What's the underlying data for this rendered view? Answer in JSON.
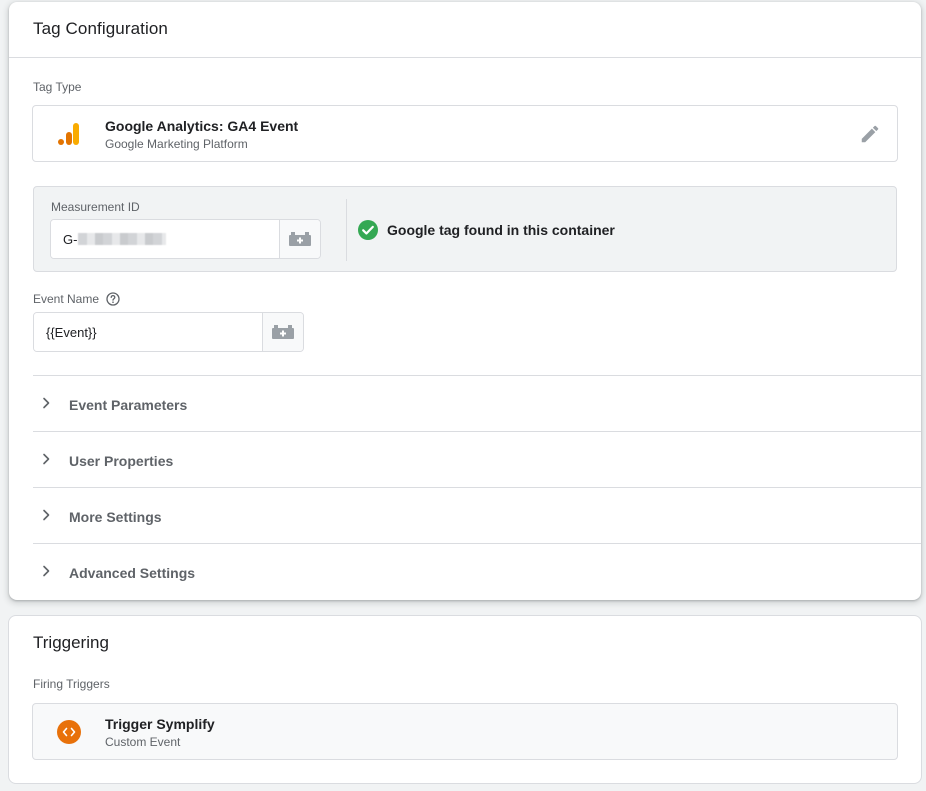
{
  "tag_config": {
    "title": "Tag Configuration",
    "tag_type_label": "Tag Type",
    "tag_type": {
      "name": "Google Analytics: GA4 Event",
      "provider": "Google Marketing Platform",
      "icon": "google-analytics-icon",
      "edit_icon": "pencil-icon"
    },
    "measurement": {
      "label": "Measurement ID",
      "value_prefix": "G-",
      "value_redacted": true,
      "variable_icon": "variable-brick-icon",
      "status_icon": "check-circle-icon",
      "status_text": "Google tag found in this container"
    },
    "event_name": {
      "label": "Event Name",
      "help_icon": "help-circle-icon",
      "value": "{{Event}}",
      "variable_icon": "variable-brick-icon"
    },
    "sections": [
      {
        "label": "Event Parameters",
        "icon": "chevron-right-icon"
      },
      {
        "label": "User Properties",
        "icon": "chevron-right-icon"
      },
      {
        "label": "More Settings",
        "icon": "chevron-right-icon"
      },
      {
        "label": "Advanced Settings",
        "icon": "chevron-right-icon"
      }
    ]
  },
  "triggering": {
    "title": "Triggering",
    "firing_label": "Firing Triggers",
    "triggers": [
      {
        "name": "Trigger Symplify",
        "type": "Custom Event",
        "icon": "code-brackets-icon"
      }
    ]
  },
  "colors": {
    "background": "#f1f3f4",
    "ga_orange_dark": "#e37400",
    "ga_orange_light": "#f9ab00",
    "success_green": "#34a853",
    "trigger_orange": "#e8710a",
    "secondary_text": "#5f6368"
  }
}
